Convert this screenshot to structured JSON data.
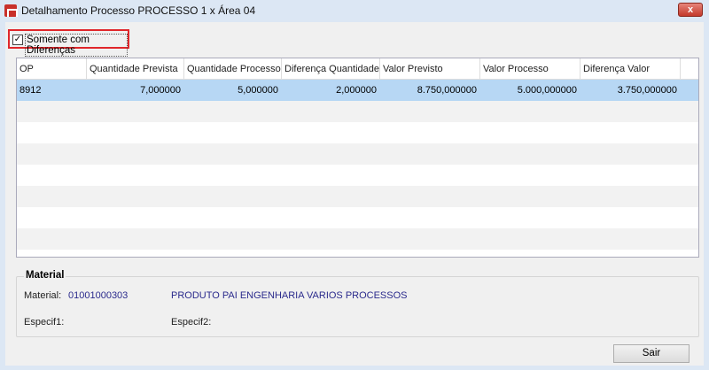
{
  "window": {
    "title": "Detalhamento Processo PROCESSO 1 x Área 04",
    "close_label": "x"
  },
  "filter": {
    "label": "Somente com Diferenças",
    "checked": true
  },
  "grid": {
    "columns": [
      "OP",
      "Quantidade Prevista",
      "Quantidade Processo",
      "Diferença Quantidade",
      "Valor Previsto",
      "Valor Processo",
      "Diferença Valor"
    ],
    "rows": [
      [
        "8912",
        "7,000000",
        "5,000000",
        "2,000000",
        "8.750,000000",
        "5.000,000000",
        "3.750,000000"
      ]
    ]
  },
  "material": {
    "group_title": "Material",
    "material_label": "Material:",
    "material_code": "01001000303",
    "material_desc": "PRODUTO PAI ENGENHARIA VARIOS PROCESSOS",
    "especif1_label": "Especif1:",
    "especif2_label": "Especif2:"
  },
  "buttons": {
    "exit": "Sair"
  }
}
